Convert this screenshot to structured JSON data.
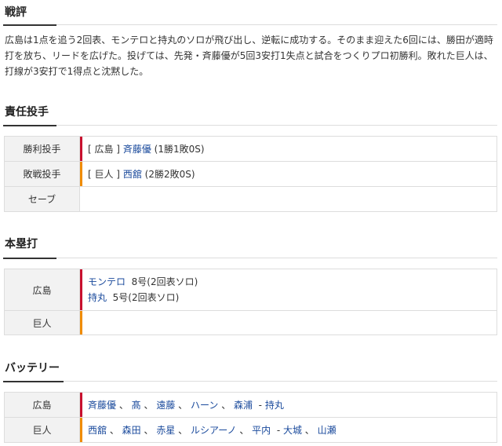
{
  "commentary": {
    "title": "戦評",
    "text": "広島は1点を追う2回表、モンテロと持丸のソロが飛び出し、逆転に成功する。そのまま迎えた6回には、勝田が適時打を放ち、リードを広げた。投げては、先発・斉藤優が5回3安打1失点と試合をつくりプロ初勝利。敗れた巨人は、打線が3安打で1得点と沈黙した。"
  },
  "pitchers": {
    "title": "責任投手",
    "rows": [
      {
        "label": "勝利投手",
        "team": "[ 広島 ]",
        "name": "斉藤優",
        "stats": "(1勝1敗0S)",
        "color": "#c8102e"
      },
      {
        "label": "敗戦投手",
        "team": "[ 巨人 ]",
        "name": "西舘",
        "stats": "(2勝2敗0S)",
        "color": "#f08c00"
      },
      {
        "label": "セーブ",
        "team": "",
        "name": "",
        "stats": ""
      }
    ]
  },
  "homeruns": {
    "title": "本塁打",
    "rows": [
      {
        "label": "広島",
        "color": "#c8102e",
        "entries": [
          {
            "name": "モンテロ",
            "detail": "8号(2回表ソロ)"
          },
          {
            "name": "持丸",
            "detail": "5号(2回表ソロ)"
          }
        ]
      },
      {
        "label": "巨人",
        "color": "#f08c00",
        "entries": []
      }
    ]
  },
  "battery": {
    "title": "バッテリー",
    "rows": [
      {
        "label": "広島",
        "color": "#c8102e",
        "pitchers": [
          "斉藤優",
          "髙",
          "遠藤",
          "ハーン",
          "森浦"
        ],
        "catchers": [
          "持丸"
        ]
      },
      {
        "label": "巨人",
        "color": "#f08c00",
        "pitchers": [
          "西舘",
          "森田",
          "赤星",
          "ルシアーノ",
          "平内"
        ],
        "catchers": [
          "大城",
          "山瀬"
        ]
      }
    ]
  }
}
